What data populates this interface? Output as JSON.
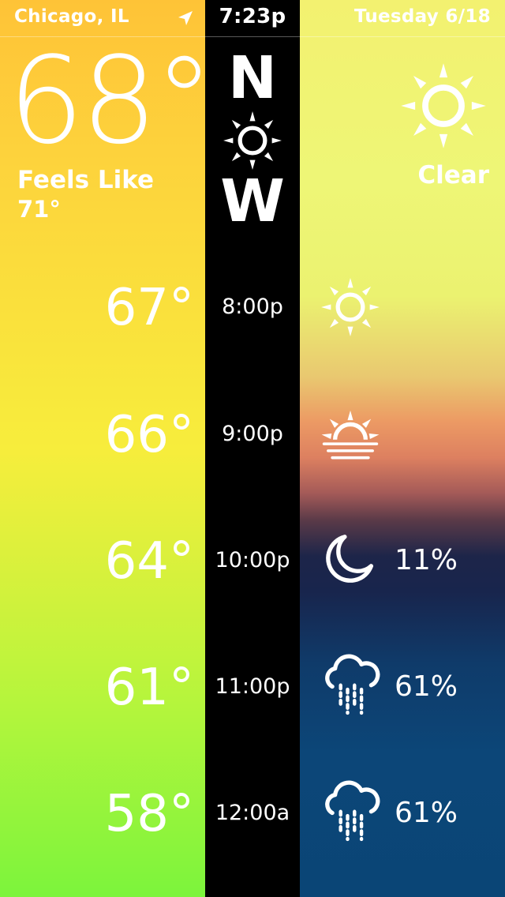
{
  "status_bar": {
    "location": "Chicago, IL",
    "location_icon": "location-arrow-icon",
    "time": "7:23p",
    "date": "Tuesday 6/18"
  },
  "current": {
    "temperature": "68°",
    "feels_like_label": "Feels Like",
    "feels_like_value": "71°",
    "now_letters": [
      "N",
      "W"
    ],
    "now_icon": "sun-icon",
    "condition_icon": "sun-icon",
    "condition": "Clear"
  },
  "hourly": [
    {
      "temp": "67°",
      "time": "8:00p",
      "icon": "sun-icon",
      "precip": ""
    },
    {
      "temp": "66°",
      "time": "9:00p",
      "icon": "sunset-icon",
      "precip": ""
    },
    {
      "temp": "64°",
      "time": "10:00p",
      "icon": "moon-icon",
      "precip": "11%"
    },
    {
      "temp": "61°",
      "time": "11:00p",
      "icon": "rain-cloud-icon",
      "precip": "61%"
    },
    {
      "temp": "58°",
      "time": "12:00a",
      "icon": "rain-cloud-icon",
      "precip": "61%"
    }
  ],
  "colors": {
    "left_top": "#fec337",
    "left_bottom": "#7cf43c",
    "middle": "#000000",
    "right_top": "#f3f170",
    "sunset": "#ec9a64",
    "night": "#0a4576",
    "text": "#ffffff"
  }
}
